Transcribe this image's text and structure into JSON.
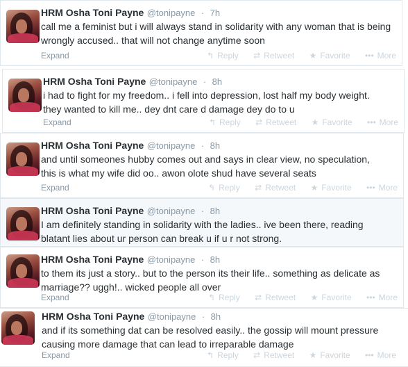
{
  "tweets": [
    {
      "name": "HRM Osha Toni Payne",
      "handle": "@tonipayne",
      "time": "7h",
      "line1": "call me a feminist but i will always stand in solidarity with any woman that is being",
      "line2": "wrongly accused.. that will not change anytime soon",
      "expand": "Expand"
    },
    {
      "name": "HRM Osha Toni Payne",
      "handle": "@tonipayne",
      "time": "8h",
      "line1": "i had to fight for my freedom.. i fell into depression, lost half my body weight.",
      "line2": "they wanted to kill me.. dey dnt care d damage dey do to u",
      "expand": "Expand"
    },
    {
      "name": "HRM Osha Toni Payne",
      "handle": "@tonipayne",
      "time": "8h",
      "line1": "and until someones hubby comes out and says in clear view, no speculation,",
      "line2": "this is what my wife did oo.. awon olote shud have several seats",
      "expand": "Expand"
    },
    {
      "name": "HRM Osha Toni Payne",
      "handle": "@tonipayne",
      "time": "8h",
      "line1": "I am definitely standing in solidarity with the ladies.. ive been there, reading",
      "line2": "blatant lies about ur person can break u if u r not strong.",
      "expand": ""
    },
    {
      "name": "HRM Osha Toni Payne",
      "handle": "@tonipayne",
      "time": "8h",
      "line1": "to them its just a story.. but to the person its their life.. something as delicate as",
      "line2": "marriage?? uggh!.. wicked people all over",
      "expand": "Expand"
    },
    {
      "name": "HRM Osha Toni Payne",
      "handle": "@tonipayne",
      "time": "8h",
      "line1": "and if its something dat can be resolved easily.. the gossip will mount pressure",
      "line2": "causing more damage that can lead to irreparable damage",
      "expand": "Expand"
    }
  ],
  "actions": {
    "reply": "Reply",
    "retweet": "Retweet",
    "favorite": "Favorite",
    "more": "More"
  },
  "icons": {
    "reply": "reply-arrow-icon",
    "retweet": "retweet-arrows-icon",
    "favorite": "star-icon",
    "more": "ellipsis-icon"
  },
  "colors": {
    "text": "#292f33",
    "muted": "#8899a6",
    "action": "#ccd6dd",
    "border": "#e1e8ed",
    "highlight_bg": "#f5f8fa"
  }
}
